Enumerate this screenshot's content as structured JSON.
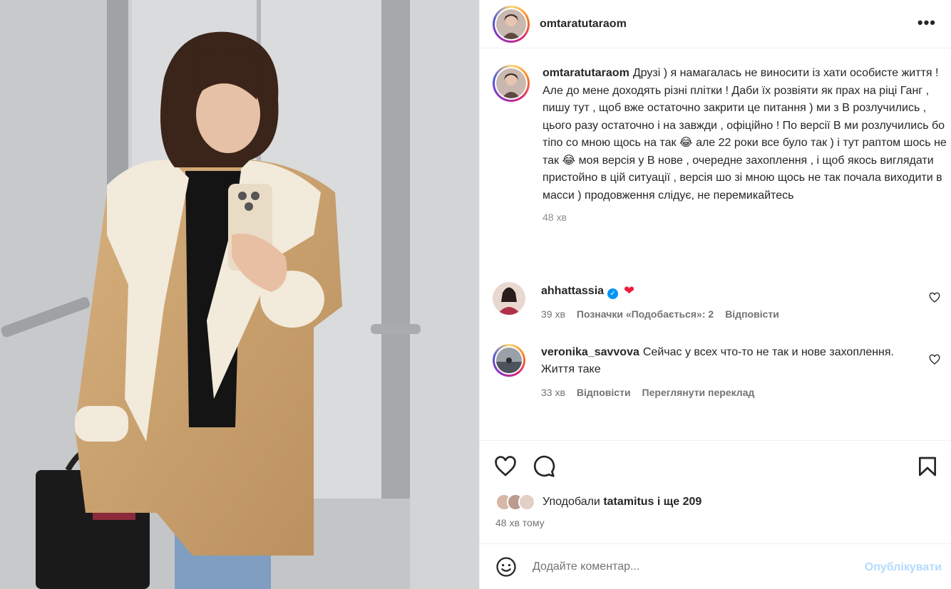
{
  "post": {
    "username": "omtaratutaraom",
    "more_icon": "more-horizontal-icon",
    "caption": {
      "username": "omtaratutaraom",
      "text": "Друзі ) я намагалась не виносити із хати особисте життя ! Але до мене доходять різні плітки ! Даби їх розвіяти як прах на ріці Ганг , пишу тут , щоб вже остаточно закрити це питання ) ми з В розлучились , цього разу остаточно і на завжди , офіційно ! По версії В ми розлучились бо тіпо со мною щось на так 😂 але 22 роки все було так ) і тут раптом шось не так 😂 моя версія у В нове , очередне захоплення , і щоб якось виглядати пристойно в цій ситуації , версія шо зі мною щось не так почала виходити в масси ) продовження слідує, не перемикайтесь",
      "time": "48 хв"
    },
    "comments": [
      {
        "username": "ahhattassia",
        "verified": true,
        "text": "❤",
        "time": "39 хв",
        "likes": "Позначки «Подобається»: 2",
        "reply": "Відповісти"
      },
      {
        "username": "veronika_savvova",
        "verified": false,
        "text": "Сейчас у всех что-то не так и нове захоплення. Життя таке",
        "time": "33 хв",
        "reply": "Відповісти",
        "translate": "Переглянути переклад"
      }
    ],
    "liked_by": {
      "prefix": "Уподобали",
      "user": "tatamitus",
      "suffix": "і ще 209"
    },
    "posted": "48 хв тому",
    "comment_box": {
      "placeholder": "Додайте коментар...",
      "publish": "Опублікувати"
    }
  },
  "colors": {
    "link_blue": "#0095f6",
    "publish_disabled": "#b3dbff",
    "secondary_text": "#737373"
  }
}
